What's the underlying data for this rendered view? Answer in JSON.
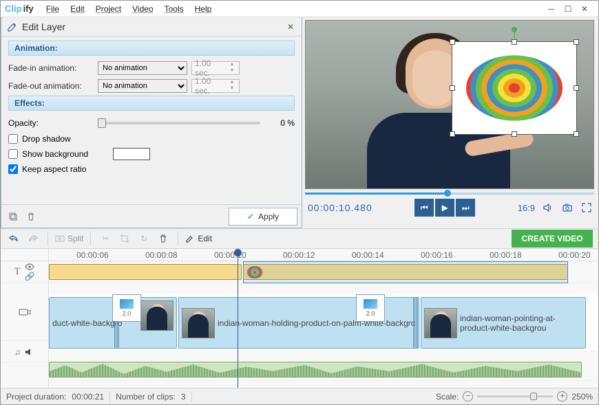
{
  "app": {
    "name_prefix": "Clip",
    "name_suffix": "ify"
  },
  "menu": {
    "file": "File",
    "edit": "Edit",
    "project": "Project",
    "video": "Video",
    "tools": "Tools",
    "help": "Help"
  },
  "panel": {
    "title": "Edit Layer",
    "sections": {
      "animation": "Animation:",
      "effects": "Effects:"
    },
    "fade_in_label": "Fade-in animation:",
    "fade_out_label": "Fade-out animation:",
    "fade_in_value": "No animation",
    "fade_out_value": "No animation",
    "fade_in_sec": "1.00 sec.",
    "fade_out_sec": "1.00 sec.",
    "opacity_label": "Opacity:",
    "opacity_value": "0 %",
    "drop_shadow": "Drop shadow",
    "show_background": "Show background",
    "keep_aspect": "Keep aspect ratio",
    "apply": "Apply"
  },
  "preview": {
    "timecode": "00:00:10.480",
    "aspect": "16:9"
  },
  "toolbar": {
    "split": "Split",
    "edit": "Edit",
    "create": "CREATE VIDEO"
  },
  "timeline": {
    "ticks": [
      "00:00:06",
      "00:00:08",
      "00:00:10",
      "00:00:12",
      "00:00:14",
      "00:00:16",
      "00:00:18",
      "00:00:20"
    ],
    "v1_label": "duct-white-backgro",
    "v2_label": "indian-woman-holding-product-on-palm-white-backgro",
    "v3_label": "indian-woman-pointing-at-product-white-backgrou",
    "trans_time": "2.0"
  },
  "status": {
    "duration_label": "Project duration:",
    "duration": "00:00:21",
    "clips_label": "Number of clips:",
    "clips": "3",
    "scale_label": "Scale:",
    "scale_value": "250%"
  }
}
